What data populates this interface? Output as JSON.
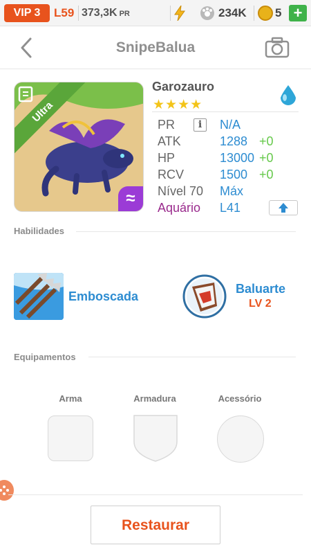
{
  "status": {
    "vip": "VIP 3",
    "level": "L59",
    "power": "373,3K",
    "power_unit": "PR",
    "energy": "",
    "food": "234K",
    "gems": "5",
    "plus": "+"
  },
  "header": {
    "title": "SnipeBalua"
  },
  "monster": {
    "rarity": "Ultra",
    "name": "Garozauro",
    "stars": 4,
    "element": "water",
    "badge_symbol": "≈"
  },
  "stats": {
    "pr": {
      "label": "PR",
      "info": "i",
      "value": "N/A"
    },
    "atk": {
      "label": "ATK",
      "value": "1288",
      "bonus": "+0"
    },
    "hp": {
      "label": "HP",
      "value": "13000",
      "bonus": "+0"
    },
    "rcv": {
      "label": "RCV",
      "value": "1500",
      "bonus": "+0"
    },
    "nivel": {
      "label": "Nível 70",
      "value": "Máx"
    },
    "aquario": {
      "label": "Aquário",
      "value": "L41"
    }
  },
  "skills": {
    "title": "Habilidades",
    "items": [
      {
        "name": "Emboscada",
        "icon": "arrows-icon"
      },
      {
        "name": "Baluarte",
        "level": "LV 2",
        "icon": "shield-icon"
      }
    ]
  },
  "equipment": {
    "title": "Equipamentos",
    "slots": [
      {
        "label": "Arma",
        "shape": "rounded-square"
      },
      {
        "label": "Armadura",
        "shape": "shield"
      },
      {
        "label": "Acessório",
        "shape": "circle"
      }
    ]
  },
  "actions": {
    "restore": "Restaurar"
  },
  "colors": {
    "accent": "#e8531d",
    "stat_value": "#2d8cd1",
    "bonus": "#66c94b",
    "rarity_ribbon": "#5aa63a",
    "aquario": "#9a2b8d"
  }
}
